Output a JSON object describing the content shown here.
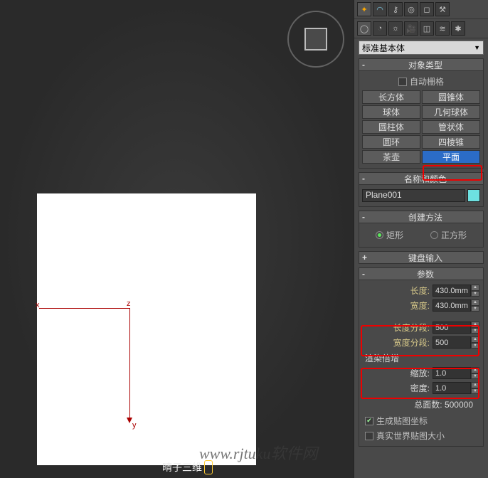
{
  "dropdown": {
    "value": "标准基本体"
  },
  "objectType": {
    "title": "对象类型",
    "autogrid_label": "自动栅格",
    "items": [
      "长方体",
      "圆锥体",
      "球体",
      "几何球体",
      "圆柱体",
      "管状体",
      "圆环",
      "四棱锥",
      "茶壶",
      "平面"
    ],
    "active": "平面"
  },
  "nameColor": {
    "title": "名称和颜色",
    "name": "Plane001"
  },
  "createMethod": {
    "title": "创建方法",
    "rect": "矩形",
    "square": "正方形"
  },
  "keyboard": {
    "title": "键盘输入"
  },
  "params": {
    "title": "参数",
    "length_label": "长度:",
    "length_val": "430.0mm",
    "width_label": "宽度:",
    "width_val": "430.0mm",
    "lseg_label": "长度分段:",
    "lseg_val": "500",
    "wseg_label": "宽度分段:",
    "wseg_val": "500",
    "render_group": "渲染倍增",
    "scale_label": "缩放:",
    "scale_val": "1.0",
    "density_label": "密度:",
    "density_val": "1.0",
    "total_label": "总面数:",
    "total_val": "500000",
    "genmap_label": "生成贴图坐标",
    "realworld_label": "真实世界贴图大小"
  },
  "watermark": "www.rjtuku软件网",
  "watermark2": "晴子三维"
}
